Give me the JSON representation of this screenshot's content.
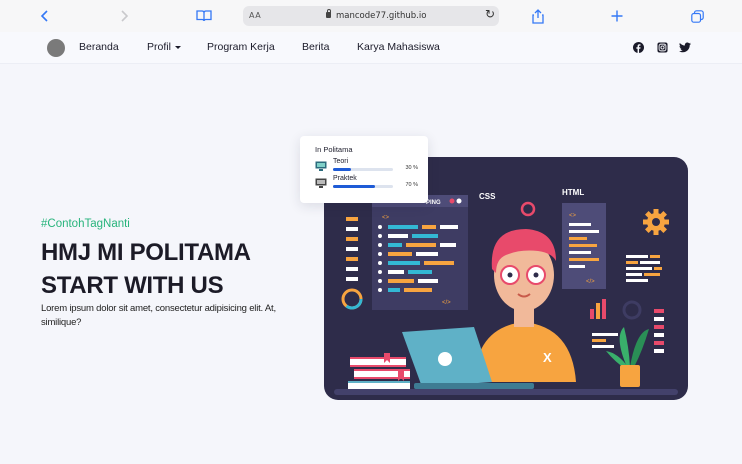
{
  "browser": {
    "url_prefix": "AA",
    "domain": "mancode77.github.io"
  },
  "nav": {
    "items": [
      "Beranda",
      "Profil",
      "Program Kerja",
      "Berita",
      "Karya Mahasiswa"
    ],
    "social_icons": [
      "facebook-icon",
      "instagram-icon",
      "twitter-icon"
    ]
  },
  "hero": {
    "subtitle": "#ContohTagNanti",
    "title": "HMJ MI POLITAMA START WITH US",
    "description": "Lorem ipsum dolor sit amet, consectetur adipisicing elit. At, similique?"
  },
  "progress_card": {
    "title": "In Politama",
    "items": [
      {
        "label": "Teori",
        "percent_text": "30 %",
        "value": 0.3,
        "icon": "monitor-icon"
      },
      {
        "label": "Praktek",
        "percent_text": "70 %",
        "value": 0.7,
        "icon": "computer-icon"
      }
    ]
  },
  "illustration": {
    "labels": [
      "TYPING",
      "CSS",
      "HTML",
      "X"
    ],
    "colors": {
      "background": "#2e2c4a",
      "accent_orange": "#f7a440",
      "accent_cyan": "#33b8d4",
      "accent_pink": "#e84a6b"
    }
  },
  "colors": {
    "accent_green": "#28b47c",
    "progress_blue": "#1e5bd6",
    "title_dark": "#1c1b27"
  }
}
